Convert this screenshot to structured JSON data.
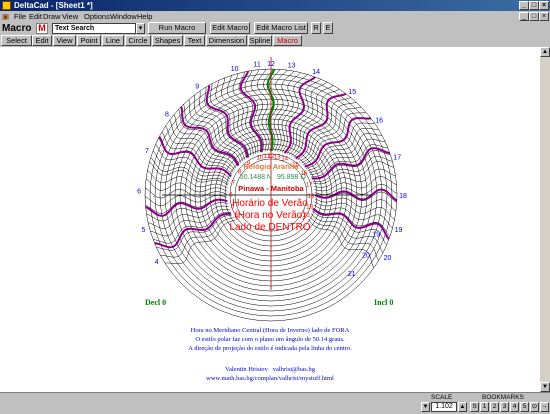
{
  "window": {
    "title": "DeltaCad - [Sheet1 *]"
  },
  "menu": [
    "File",
    "Edit",
    "Draw",
    "View",
    "Options",
    "Window",
    "Help"
  ],
  "toolbar": {
    "mode_label": "Macro",
    "mode_icon": "M",
    "search_value": "Text Search",
    "run_macro": "Run Macro",
    "edit_macro": "Edit Macro",
    "edit_macro_list": "Edit Macro List",
    "r_btn": "R",
    "e_btn": "E"
  },
  "tabs": [
    "Select",
    "Edit",
    "View",
    "Point",
    "Line",
    "Circle",
    "Shapes",
    "Text",
    "Dimension",
    "Spline",
    "Macro"
  ],
  "drawing": {
    "hour_labels_outer": [
      "4",
      "5",
      "6",
      "7",
      "8",
      "9",
      "10",
      "11",
      "12",
      "13",
      "14",
      "15",
      "16",
      "17",
      "18",
      "19",
      "20"
    ],
    "hour_labels_right": [
      "19",
      "20",
      "21"
    ],
    "center_title": "Relógio Aranha",
    "center_lat": "50.1488 N",
    "center_lon": "95.898 O",
    "center_place": "Pinawa - Manitoba",
    "main_text_1": "Horário de Verão",
    "main_text_2": "(Hora no Verão)",
    "main_text_3": "Lado de DENTRO",
    "decl_left": "Decl 0",
    "incl_right": "Incl 0",
    "footer_1": "Hora no Meridiano Central (Hora de Inverno) lado de FORA",
    "footer_2": "O estilo polar faz com o plano um ângulo de 50.14 graus.",
    "footer_3": "A direção de projeção do estilo é indicada pela linha do centro.",
    "author": "Valentin Hristov",
    "email": "valhrist@bas.bg",
    "url": "www.math.bas.bg/complan/valhrist/mystuff.html",
    "colors": {
      "purple": "#8b008b",
      "green": "#008000",
      "blue": "#0000ff",
      "red": "#ff0000"
    }
  },
  "status": {
    "scale_label": "SCALE",
    "scale_value": "1.102",
    "bookmarks_label": "BOOKMARKS",
    "bookmarks": [
      "S",
      "1",
      "2",
      "3",
      "4",
      "5"
    ]
  }
}
